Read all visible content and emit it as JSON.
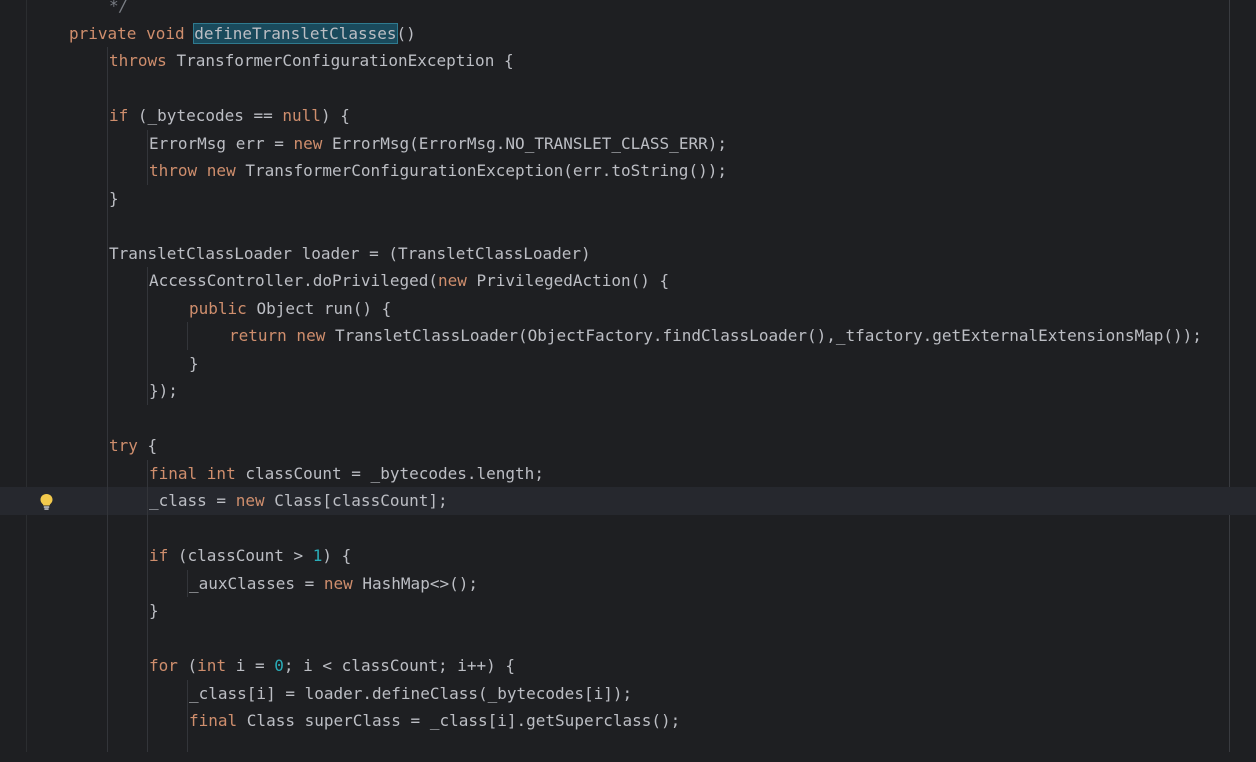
{
  "editor": {
    "language": "java",
    "current_line_index": 18,
    "lines": [
      {
        "indent": 1,
        "tokens": [
          {
            "t": "*/",
            "c": "cm"
          }
        ]
      },
      {
        "indent": 0,
        "tokens": [
          {
            "t": "private void ",
            "c": "kw0"
          },
          {
            "t": "defineTransletClasses",
            "c": "sel"
          },
          {
            "t": "()",
            "c": ""
          }
        ]
      },
      {
        "indent": 1,
        "tokens": [
          {
            "t": "throws ",
            "c": "kw"
          },
          {
            "t": "TransformerConfigurationException {",
            "c": ""
          }
        ]
      },
      {
        "indent": 0,
        "tokens": []
      },
      {
        "indent": 1,
        "tokens": [
          {
            "t": "if ",
            "c": "kw"
          },
          {
            "t": "(_bytecodes == ",
            "c": ""
          },
          {
            "t": "null",
            "c": "kw"
          },
          {
            "t": ") {",
            "c": ""
          }
        ]
      },
      {
        "indent": 2,
        "tokens": [
          {
            "t": "ErrorMsg err = ",
            "c": ""
          },
          {
            "t": "new ",
            "c": "kw"
          },
          {
            "t": "ErrorMsg(ErrorMsg.NO_TRANSLET_CLASS_ERR);",
            "c": ""
          }
        ]
      },
      {
        "indent": 2,
        "tokens": [
          {
            "t": "throw new ",
            "c": "kw"
          },
          {
            "t": "TransformerConfigurationException(err.toString());",
            "c": ""
          }
        ]
      },
      {
        "indent": 1,
        "tokens": [
          {
            "t": "}",
            "c": ""
          }
        ]
      },
      {
        "indent": 0,
        "tokens": []
      },
      {
        "indent": 1,
        "tokens": [
          {
            "t": "TransletClassLoader loader = (TransletClassLoader)",
            "c": ""
          }
        ]
      },
      {
        "indent": 2,
        "tokens": [
          {
            "t": "AccessController.doPrivileged(",
            "c": ""
          },
          {
            "t": "new ",
            "c": "kw"
          },
          {
            "t": "PrivilegedAction() {",
            "c": ""
          }
        ]
      },
      {
        "indent": 3,
        "tokens": [
          {
            "t": "public ",
            "c": "kw"
          },
          {
            "t": "Object run() {",
            "c": ""
          }
        ]
      },
      {
        "indent": 4,
        "tokens": [
          {
            "t": "return new ",
            "c": "kw"
          },
          {
            "t": "TransletClassLoader(ObjectFactory.findClassLoader(),_tfactory.getExternalExtensionsMap());",
            "c": ""
          }
        ]
      },
      {
        "indent": 3,
        "tokens": [
          {
            "t": "}",
            "c": ""
          }
        ]
      },
      {
        "indent": 2,
        "tokens": [
          {
            "t": "});",
            "c": ""
          }
        ]
      },
      {
        "indent": 0,
        "tokens": []
      },
      {
        "indent": 1,
        "tokens": [
          {
            "t": "try ",
            "c": "kw"
          },
          {
            "t": "{",
            "c": ""
          }
        ]
      },
      {
        "indent": 2,
        "tokens": [
          {
            "t": "final int ",
            "c": "kw"
          },
          {
            "t": "classCount = _bytecodes.length;",
            "c": ""
          }
        ]
      },
      {
        "indent": 2,
        "tokens": [
          {
            "t": "_class = ",
            "c": ""
          },
          {
            "t": "new ",
            "c": "kw"
          },
          {
            "t": "Class[classCount];",
            "c": ""
          }
        ]
      },
      {
        "indent": 0,
        "tokens": []
      },
      {
        "indent": 2,
        "tokens": [
          {
            "t": "if ",
            "c": "kw"
          },
          {
            "t": "(classCount > ",
            "c": ""
          },
          {
            "t": "1",
            "c": "num"
          },
          {
            "t": ") {",
            "c": ""
          }
        ]
      },
      {
        "indent": 3,
        "tokens": [
          {
            "t": "_auxClasses = ",
            "c": ""
          },
          {
            "t": "new ",
            "c": "kw"
          },
          {
            "t": "HashMap<>();",
            "c": ""
          }
        ]
      },
      {
        "indent": 2,
        "tokens": [
          {
            "t": "}",
            "c": ""
          }
        ]
      },
      {
        "indent": 0,
        "tokens": []
      },
      {
        "indent": 2,
        "tokens": [
          {
            "t": "for ",
            "c": "kw"
          },
          {
            "t": "(",
            "c": ""
          },
          {
            "t": "int ",
            "c": "kw"
          },
          {
            "t": "i = ",
            "c": ""
          },
          {
            "t": "0",
            "c": "num"
          },
          {
            "t": "; i < classCount; i++) {",
            "c": ""
          }
        ]
      },
      {
        "indent": 3,
        "tokens": [
          {
            "t": "_class[i] = loader.defineClass(_bytecodes[i]);",
            "c": ""
          }
        ]
      },
      {
        "indent": 3,
        "tokens": [
          {
            "t": "final ",
            "c": "kw"
          },
          {
            "t": "Class superClass = _class[i].getSuperclass();",
            "c": ""
          }
        ]
      },
      {
        "indent": 0,
        "tokens": []
      }
    ]
  },
  "gutter": {
    "intention_icon": "lightbulb-icon",
    "intention_line_index": 18
  },
  "colors": {
    "background": "#1e1f22",
    "current_line": "#26282e",
    "text": "#bcbec4",
    "keyword": "#cf8e6d",
    "number": "#2aacb8",
    "comment": "#7a7e85",
    "selection": "#1a4a5c",
    "bulb": "#f2c94c"
  }
}
